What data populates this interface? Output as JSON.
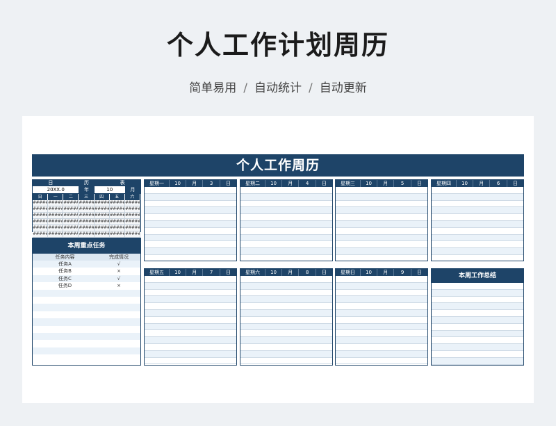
{
  "header": {
    "title": "个人工作计划周历",
    "tags": [
      "简单易用",
      "自动统计",
      "自动更新"
    ],
    "separator": "/"
  },
  "sheet": {
    "banner": "个人工作周历",
    "calendar": {
      "head": [
        "日",
        "历",
        "表"
      ],
      "year_value": "20XX.0",
      "year_label": "年",
      "month_value": "10",
      "month_label": "月",
      "weekdays": [
        "日",
        "一",
        "二",
        "三",
        "四",
        "五",
        "六"
      ],
      "cell": "#####"
    },
    "tasks": {
      "title": "本周重点任务",
      "col_content": "任务内容",
      "col_status": "完成情况",
      "items": [
        {
          "name": "任务A",
          "status": "√"
        },
        {
          "name": "任务B",
          "status": "×"
        },
        {
          "name": "任务C",
          "status": "√"
        },
        {
          "name": "任务D",
          "status": "×"
        }
      ]
    },
    "days": [
      {
        "weekday": "星期一",
        "month": "10",
        "month_unit": "月",
        "day": "3",
        "day_unit": "日"
      },
      {
        "weekday": "星期二",
        "month": "10",
        "month_unit": "月",
        "day": "4",
        "day_unit": "日"
      },
      {
        "weekday": "星期三",
        "month": "10",
        "month_unit": "月",
        "day": "5",
        "day_unit": "日"
      },
      {
        "weekday": "星期四",
        "month": "10",
        "month_unit": "月",
        "day": "6",
        "day_unit": "日"
      },
      {
        "weekday": "星期五",
        "month": "10",
        "month_unit": "月",
        "day": "7",
        "day_unit": "日"
      },
      {
        "weekday": "星期六",
        "month": "10",
        "month_unit": "月",
        "day": "8",
        "day_unit": "日"
      },
      {
        "weekday": "星期日",
        "month": "10",
        "month_unit": "月",
        "day": "9",
        "day_unit": "日"
      }
    ],
    "summary": {
      "title": "本周工作总结"
    }
  },
  "colors": {
    "navy": "#1e4468",
    "row_alt": "#eaf2f9"
  }
}
